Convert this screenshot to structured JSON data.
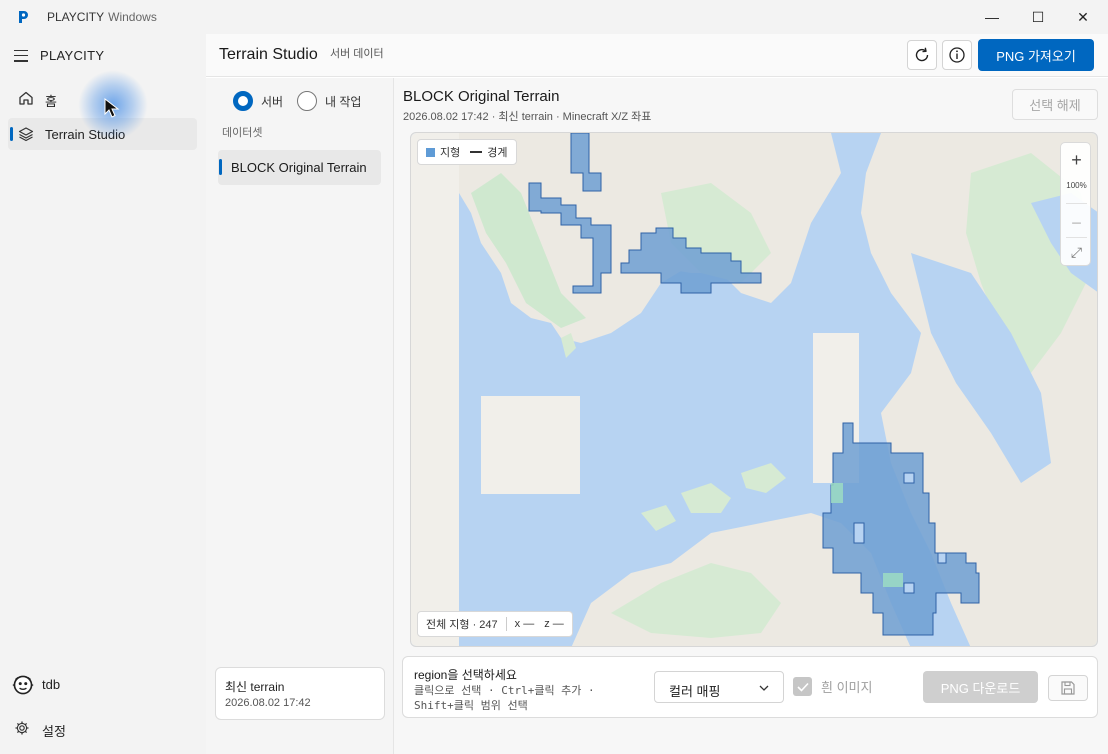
{
  "window": {
    "app_name": "PLAYCITY",
    "subtitle": "Windows",
    "minimize": "—",
    "maximize": "☐",
    "close": "✕"
  },
  "sidebar": {
    "brand": "PLAYCITY",
    "items": [
      {
        "label": "홈",
        "icon": "home-icon"
      },
      {
        "label": "Terrain Studio",
        "icon": "layers-icon"
      }
    ],
    "user": {
      "label": "tdb",
      "icon": "avatar-icon"
    },
    "settings": {
      "label": "설정",
      "icon": "gear-icon"
    }
  },
  "header": {
    "title": "Terrain Studio",
    "subtitle": "서버 데이터",
    "export_label": "PNG 가져오기",
    "refresh_icon": "refresh-icon",
    "info_icon": "info-icon"
  },
  "datasets": {
    "source_options": [
      {
        "label": "서버",
        "checked": true
      },
      {
        "label": "내 작업",
        "checked": false
      }
    ],
    "section_label": "데이터셋",
    "items": [
      {
        "label": "BLOCK Original Terrain"
      }
    ],
    "latest": {
      "title": "최신 terrain",
      "date": "2026.08.02 17:42"
    }
  },
  "content": {
    "title": "BLOCK Original Terrain",
    "meta": "2026.08.02 17:42 · 최신 terrain · Minecraft X/Z 좌표",
    "deselect_label": "선택 해제",
    "map": {
      "legend": {
        "fill_label": "지형",
        "line_label": "경계",
        "fill_color": "#5f9bd6"
      },
      "zoom": {
        "in": "+",
        "level": "100%",
        "out": "−",
        "fit": "⤢"
      },
      "status": {
        "total": "전체 지형 · 247",
        "x": "x —",
        "z": "z —"
      }
    },
    "footer": {
      "prompt": "region을 선택하세요",
      "hint": "클릭으로 선택 · Ctrl+클릭 추가 · Shift+클릭 범위 선택",
      "color_mode": "컬러 매핑",
      "checkbox_label": "흰 이미지",
      "checkbox_checked": true,
      "download_label": "PNG 다운로드"
    }
  },
  "colors": {
    "accent": "#0067c0",
    "water": "#b7d3f2",
    "land": "#ece9e2",
    "vegetation": "#cfe8cf",
    "region_fill": "#5f9bd6"
  }
}
